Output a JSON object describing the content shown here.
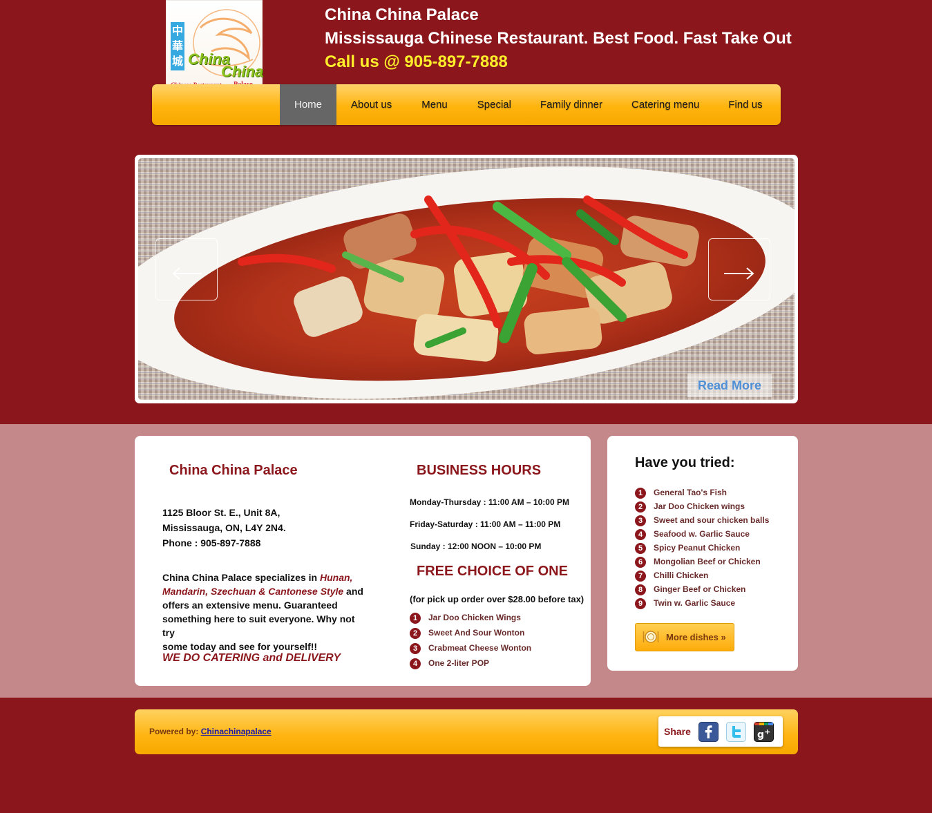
{
  "header": {
    "title": "China China Palace",
    "tagline": "Mississauga Chinese Restaurant. Best Food. Fast Take Out",
    "call": "Call us @ 905-897-7888",
    "logo": {
      "chinese": "中華城",
      "name_line1": "China",
      "name_line2": "China",
      "subtitle": "Chinese Restaurant",
      "palace": "Palace"
    }
  },
  "nav": {
    "items": [
      {
        "label": "Home",
        "active": true
      },
      {
        "label": "About us"
      },
      {
        "label": "Menu"
      },
      {
        "label": "Special"
      },
      {
        "label": "Family dinner"
      },
      {
        "label": "Catering menu"
      },
      {
        "label": "Find us"
      }
    ]
  },
  "slider": {
    "prev_icon": "arrow-left-icon",
    "next_icon": "arrow-right-icon",
    "read_more": "Read More"
  },
  "info": {
    "name": "China China Palace",
    "address_line1": "1125 Bloor St. E., Unit 8A,",
    "address_line2": "Mississauga, ON, L4Y 2N4.",
    "phone": "Phone : 905-897-7888",
    "desc_prefix": "China China Palace specializes in ",
    "desc_styles_1": "Hunan,",
    "desc_styles_2": "Mandarin, Szechuan & Cantonese Style",
    "desc_suffix_1": " and",
    "desc_line3": "offers an extensive menu. Guaranteed",
    "desc_line4": "something here to suit everyone. Why not try",
    "desc_line5": "some today and see for yourself!!",
    "catering": "WE DO CATERING and DELIVERY"
  },
  "hours": {
    "heading": "BUSINESS HOURS",
    "rows": [
      {
        "days": "Monday-Thursday",
        "time": " : 11:00 AM – 10:00 PM"
      },
      {
        "days": "Friday-Saturday",
        "time": " : 11:00 AM – 11:00 PM"
      },
      {
        "days": "Sunday",
        "time": " : 12:00 NOON – 10:00 PM"
      }
    ]
  },
  "free_choice": {
    "heading": "FREE CHOICE OF ONE",
    "note": "(for pick up order over $28.00 before tax)",
    "items": [
      "Jar Doo Chicken Wings",
      "Sweet And Sour Wonton",
      "Crabmeat Cheese Wonton",
      "One 2-liter POP"
    ]
  },
  "tried": {
    "heading": "Have you tried:",
    "items": [
      "General Tao's Fish",
      "Jar Doo Chicken wings",
      "Sweet and sour chicken balls",
      "Seafood w. Garlic Sauce",
      "Spicy Peanut Chicken",
      "Mongolian Beef or Chicken",
      "Chilli Chicken",
      "Ginger Beef or Chicken",
      "Twin w. Garlic Sauce"
    ],
    "more_button": "More dishes »",
    "more_icon": "plate-icon"
  },
  "footer": {
    "powered_by": "Powered by: ",
    "link": "Chinachinapalace",
    "share_label": "Share",
    "icons": [
      "facebook-icon",
      "twitter-icon",
      "google-plus-icon"
    ]
  },
  "colors": {
    "brand_red": "#8b171c",
    "band_pink": "#c4888a",
    "nav_orange": "#ffb40e",
    "call_yellow": "#ffef2a",
    "active_nav": "#666666"
  }
}
